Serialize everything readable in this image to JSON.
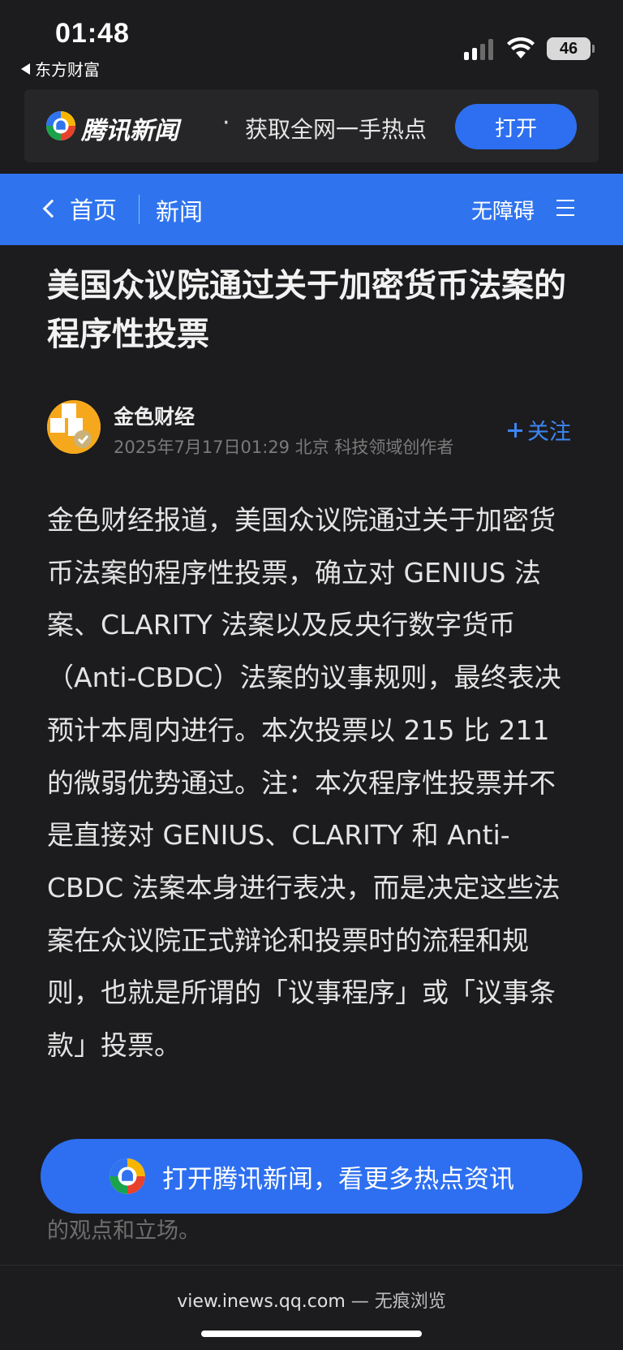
{
  "status_bar": {
    "time": "01:48",
    "back_app": "东方财富",
    "battery": "46"
  },
  "promo": {
    "brand": "腾讯新闻",
    "dot": "·",
    "slogan": "获取全网一手热点",
    "open_button": "打开"
  },
  "nav": {
    "back_label": "首页",
    "section": "新闻",
    "accessibility": "无障碍"
  },
  "article": {
    "title": "美国众议院通过关于加密货币法案的程序性投票",
    "author": {
      "name": "金色财经",
      "meta": "2025年7月17日01:29  北京  科技领域创作者",
      "follow_label": "关注"
    },
    "body": "金色财经报道，美国众议院通过关于加密货币法案的程序性投票，确立对 GENIUS 法案、CLARITY 法案以及反央行数字货币（Anti-CBDC）法案的议事规则，最终表决预计本周内进行。本次投票以 215 比 211 的微弱优势通过。注：本次程序性投票并不是直接对 GENIUS、CLARITY 和 Anti-CBDC 法案本身进行表决，而是决定这些法案在众议院正式辩论和投票时的流程和规则，也就是所谓的「议事程序」或「议事条款」投票。",
    "peek_text": "的观点和立场。"
  },
  "cta": {
    "label": "打开腾讯新闻，看更多热点资讯"
  },
  "browser": {
    "url": "view.inews.qq.com",
    "mode": " — 无痕浏览"
  },
  "colors": {
    "accent": "#2f74ee",
    "background": "#1c1c1e",
    "follow": "#3d86f6"
  }
}
